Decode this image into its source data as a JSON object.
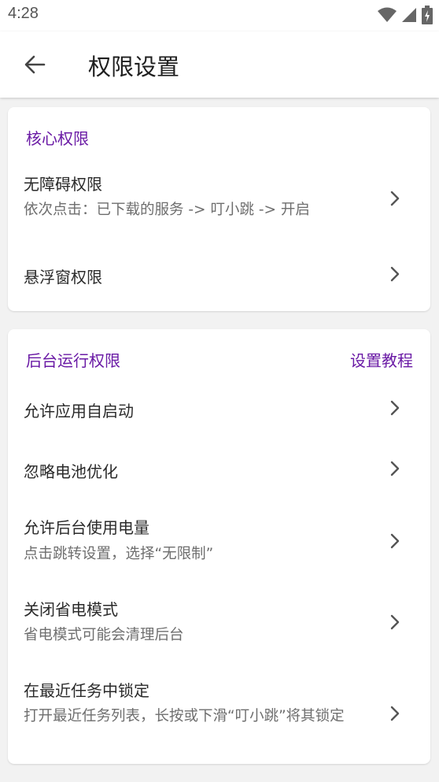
{
  "status_bar": {
    "time": "4:28",
    "icons": [
      "wifi-icon",
      "signal-icon",
      "battery-icon"
    ]
  },
  "app_bar": {
    "title": "权限设置",
    "back_icon": "arrow-left-icon"
  },
  "colors": {
    "accent": "#6a1aa5",
    "background": "#f2f2f2",
    "card": "#ffffff",
    "text_primary": "#2a2a2a",
    "text_secondary": "#6e6e6e"
  },
  "core_section": {
    "title": "核心权限",
    "items": [
      {
        "title": "无障碍权限",
        "subtitle": "依次点击：已下载的服务 -> 叮小跳 -> 开启"
      },
      {
        "title": "悬浮窗权限"
      }
    ]
  },
  "background_section": {
    "title": "后台运行权限",
    "link": "设置教程",
    "items": [
      {
        "title": "允许应用自启动"
      },
      {
        "title": "忽略电池优化"
      },
      {
        "title": "允许后台使用电量",
        "subtitle": "点击跳转设置，选择“无限制”"
      },
      {
        "title": "关闭省电模式",
        "subtitle": "省电模式可能会清理后台"
      },
      {
        "title": "在最近任务中锁定",
        "subtitle": "打开最近任务列表，长按或下滑“叮小跳”将其锁定"
      }
    ]
  }
}
